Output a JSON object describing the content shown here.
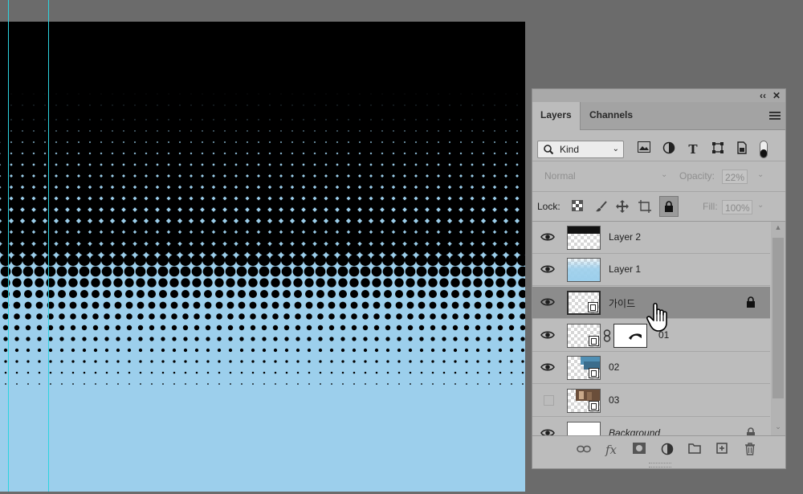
{
  "panel": {
    "collapse_label": "‹‹",
    "close_label": "✕",
    "tabs": [
      {
        "label": "Layers",
        "active": true
      },
      {
        "label": "Channels",
        "active": false
      }
    ],
    "kind_filter": {
      "value": "Kind"
    },
    "filter_icons": [
      "image-filter-icon",
      "adjustment-filter-icon",
      "type-filter-icon",
      "shape-filter-icon",
      "smart-object-filter-icon",
      "filter-toggle-icon"
    ],
    "blend_mode": "Normal",
    "opacity_label": "Opacity:",
    "opacity_value": "22%",
    "lock_label": "Lock:",
    "fill_label": "Fill:",
    "fill_value": "100%"
  },
  "layers": [
    {
      "name": "Layer 2",
      "visible": true,
      "selected": false
    },
    {
      "name": "Layer 1",
      "visible": true,
      "selected": false
    },
    {
      "name": "가이드",
      "visible": true,
      "selected": true,
      "locked": true
    },
    {
      "name": "01",
      "visible": true,
      "selected": false,
      "has_mask": true
    },
    {
      "name": "02",
      "visible": true,
      "selected": false
    },
    {
      "name": "03",
      "visible": false,
      "selected": false
    },
    {
      "name": "Background",
      "visible": true,
      "selected": false,
      "locked": true
    }
  ],
  "colors": {
    "canvas_top": "#000000",
    "canvas_sky": "#9ccfec",
    "guide": "#2cd3df",
    "panel_bg": "#bcbcbc",
    "selected_row": "#8c8c8c"
  }
}
